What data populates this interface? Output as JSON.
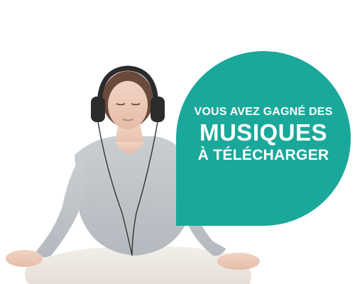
{
  "banner": {
    "line1": "VOUS AVEZ GAGNÉ DES",
    "line2": "MUSIQUES",
    "line3": "À TÉLÉCHARGER"
  },
  "colors": {
    "bubble": "#1aa89a",
    "text": "#ffffff"
  },
  "icons": {
    "photo": "woman-meditating-with-headphones"
  }
}
